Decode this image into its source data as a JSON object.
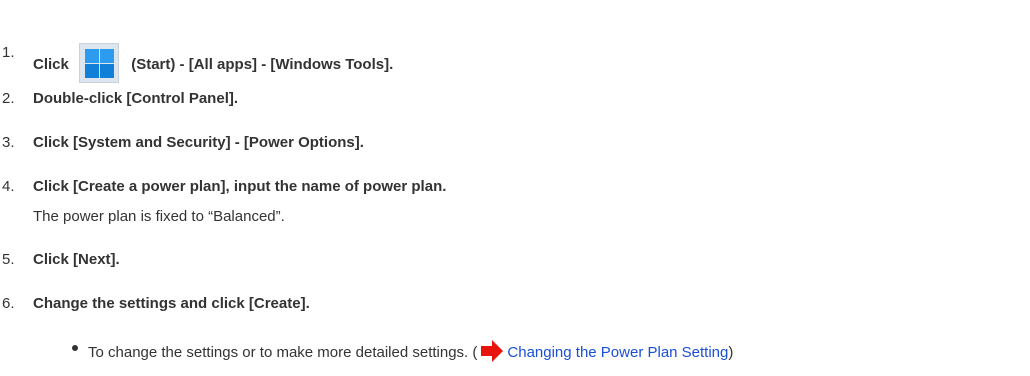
{
  "steps": [
    {
      "number": "1.",
      "before_icon": "Click",
      "after_icon": "(Start) - [All apps] - [Windows Tools].",
      "icon": "windows-start-icon"
    },
    {
      "number": "2.",
      "text": "Double-click [Control Panel]."
    },
    {
      "number": "3.",
      "text": "Click [System and Security] - [Power Options]."
    },
    {
      "number": "4.",
      "text": "Click [Create a power plan], input the name of power plan.",
      "note": "The power plan is fixed to “Balanced”."
    },
    {
      "number": "5.",
      "text": "Click [Next]."
    },
    {
      "number": "6.",
      "text": "Change the settings and click [Create]."
    }
  ],
  "bullet": {
    "text_before": "To change the settings or to make more detailed settings. (",
    "icon": "red-arrow-icon",
    "link_text": "Changing the Power Plan Setting",
    "text_after": ")"
  },
  "colors": {
    "text": "#333333",
    "link": "#1a4fd6",
    "arrow": "#e8140c",
    "start_icon": "#1a8de8"
  }
}
